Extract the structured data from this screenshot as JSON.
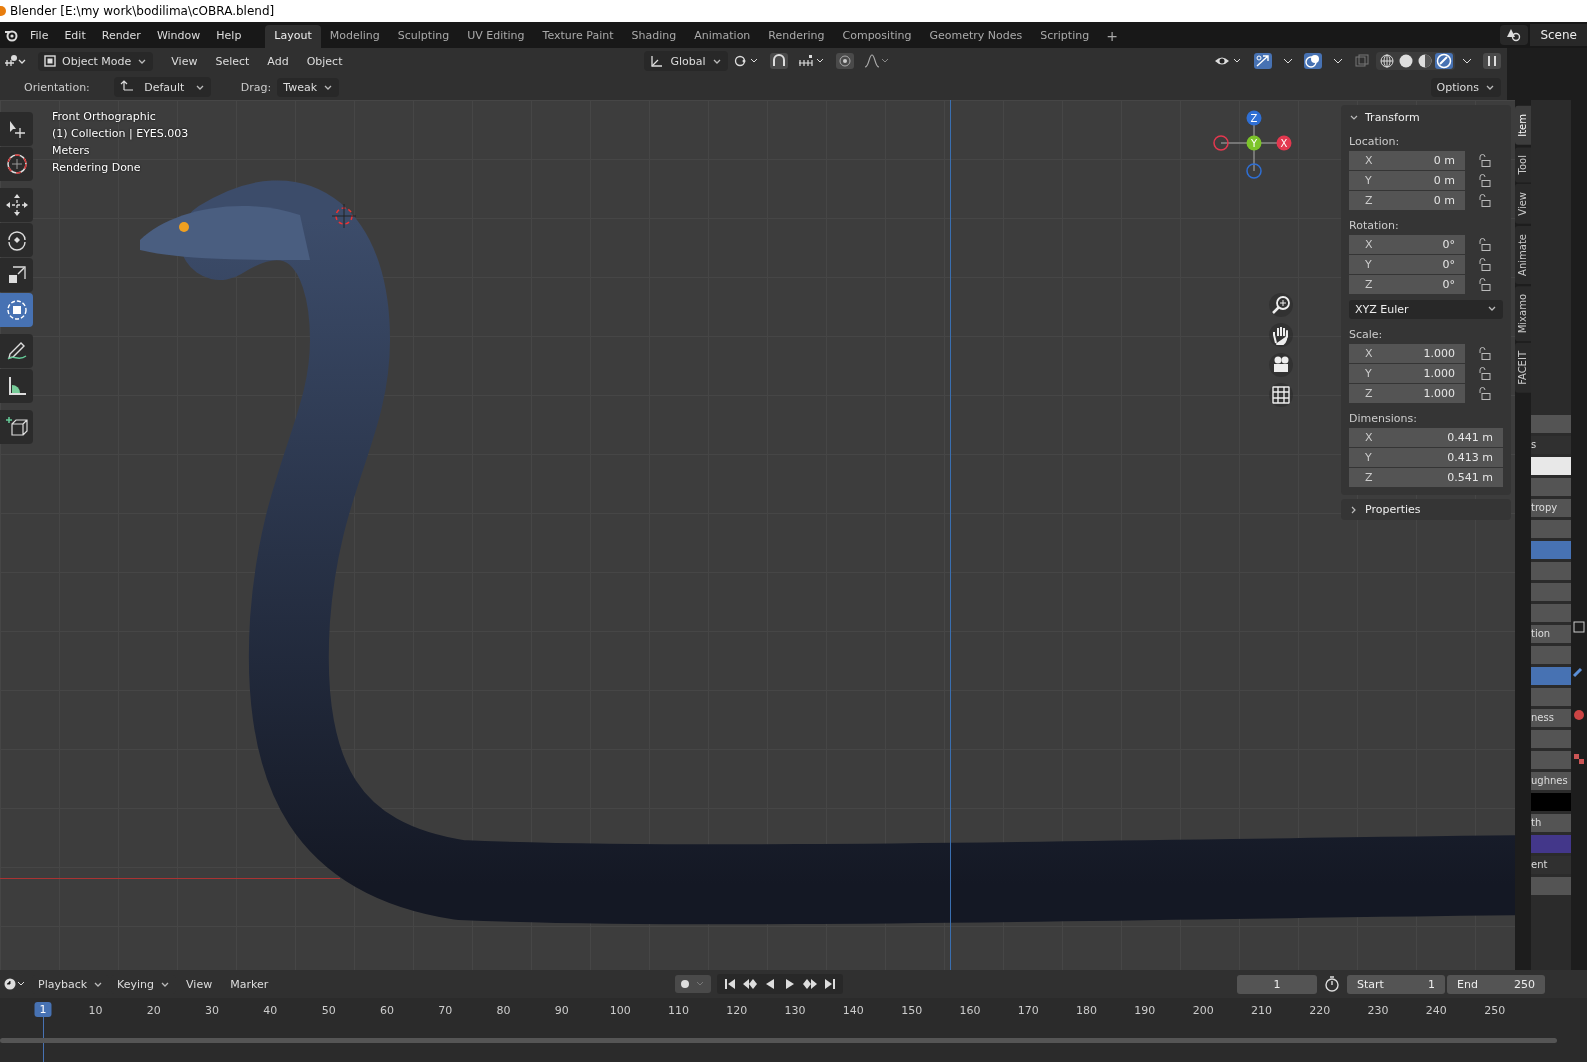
{
  "window": {
    "title": "Blender [E:\\my work\\bodilima\\cOBRA.blend]"
  },
  "menu": [
    "File",
    "Edit",
    "Render",
    "Window",
    "Help"
  ],
  "workspaces": [
    {
      "label": "Layout",
      "selected": true
    },
    {
      "label": "Modeling",
      "selected": false
    },
    {
      "label": "Sculpting",
      "selected": false
    },
    {
      "label": "UV Editing",
      "selected": false
    },
    {
      "label": "Texture Paint",
      "selected": false
    },
    {
      "label": "Shading",
      "selected": false
    },
    {
      "label": "Animation",
      "selected": false
    },
    {
      "label": "Rendering",
      "selected": false
    },
    {
      "label": "Compositing",
      "selected": false
    },
    {
      "label": "Geometry Nodes",
      "selected": false
    },
    {
      "label": "Scripting",
      "selected": false
    }
  ],
  "add_workspace": "+",
  "scene": "Scene",
  "header": {
    "mode": "Object Mode",
    "menus": [
      "View",
      "Select",
      "Add",
      "Object"
    ],
    "orientation": "Global"
  },
  "tool_settings": {
    "orientation_label": "Orientation:",
    "orientation": "Default",
    "drag_label": "Drag:",
    "drag": "Tweak",
    "options": "Options"
  },
  "toolbar": [
    {
      "kind": "select",
      "selected": false
    },
    {
      "kind": "cursor",
      "selected": false
    },
    {
      "kind": "move",
      "selected": false
    },
    {
      "kind": "rotate",
      "selected": false
    },
    {
      "kind": "scale",
      "selected": false
    },
    {
      "kind": "transform",
      "selected": true
    },
    {
      "kind": "annotate",
      "selected": false
    },
    {
      "kind": "measure",
      "selected": false
    },
    {
      "kind": "add-cube",
      "selected": false
    }
  ],
  "viewport": {
    "info": [
      "Front Orthographic",
      "(1) Collection | EYES.003",
      "Meters",
      "Rendering Done"
    ],
    "gizmo": {
      "z": "Z",
      "y": "Y",
      "x": "X"
    }
  },
  "sidebar": {
    "tabs": [
      {
        "label": "Item",
        "selected": true
      },
      {
        "label": "Tool",
        "selected": false
      },
      {
        "label": "View",
        "selected": false
      },
      {
        "label": "Animate",
        "selected": false
      },
      {
        "label": "Mixamo",
        "selected": false
      },
      {
        "label": "FACEIT",
        "selected": false
      }
    ],
    "transform": {
      "title": "Transform",
      "expanded": true,
      "groups": [
        {
          "label": "Location:",
          "lock": true,
          "rows": [
            {
              "axis": "X",
              "value": "0 m"
            },
            {
              "axis": "Y",
              "value": "0 m"
            },
            {
              "axis": "Z",
              "value": "0 m"
            }
          ]
        },
        {
          "label": "Rotation:",
          "lock": true,
          "rows": [
            {
              "axis": "X",
              "value": "0°"
            },
            {
              "axis": "Y",
              "value": "0°"
            },
            {
              "axis": "Z",
              "value": "0°"
            }
          ],
          "mode": "XYZ Euler"
        },
        {
          "label": "Scale:",
          "lock": true,
          "rows": [
            {
              "axis": "X",
              "value": "1.000"
            },
            {
              "axis": "Y",
              "value": "1.000"
            },
            {
              "axis": "Z",
              "value": "1.000"
            }
          ]
        },
        {
          "label": "Dimensions:",
          "lock": false,
          "rows": [
            {
              "axis": "X",
              "value": "0.441 m"
            },
            {
              "axis": "Y",
              "value": "0.413 m"
            },
            {
              "axis": "Z",
              "value": "0.541 m"
            }
          ]
        }
      ]
    },
    "properties": {
      "title": "Properties",
      "expanded": false
    }
  },
  "properties_strip": [
    {
      "kind": "field"
    },
    {
      "kind": "label",
      "text": "s"
    },
    {
      "kind": "swatch"
    },
    {
      "kind": "field"
    },
    {
      "kind": "field",
      "text": "tropy"
    },
    {
      "kind": "field"
    },
    {
      "kind": "accent"
    },
    {
      "kind": "field"
    },
    {
      "kind": "field"
    },
    {
      "kind": "field"
    },
    {
      "kind": "field",
      "text": "tion"
    },
    {
      "kind": "field"
    },
    {
      "kind": "accent"
    },
    {
      "kind": "field"
    },
    {
      "kind": "field",
      "text": "ness"
    },
    {
      "kind": "field"
    },
    {
      "kind": "field"
    },
    {
      "kind": "field",
      "text": "ughnes"
    },
    {
      "kind": "black"
    },
    {
      "kind": "field",
      "text": "th"
    },
    {
      "kind": "node"
    },
    {
      "kind": "label",
      "text": "ent"
    },
    {
      "kind": "field"
    }
  ],
  "timeline": {
    "menus": [
      "Playback",
      "Keying",
      "View",
      "Marker"
    ],
    "current_frame": "1",
    "start_label": "Start",
    "start": "1",
    "end_label": "End",
    "end": "250",
    "playhead": "1",
    "ticks": [
      "10",
      "20",
      "30",
      "40",
      "50",
      "60",
      "70",
      "80",
      "90",
      "100",
      "110",
      "120",
      "130",
      "140",
      "150",
      "160",
      "170",
      "180",
      "190",
      "200",
      "210",
      "220",
      "230",
      "240",
      "250"
    ]
  }
}
